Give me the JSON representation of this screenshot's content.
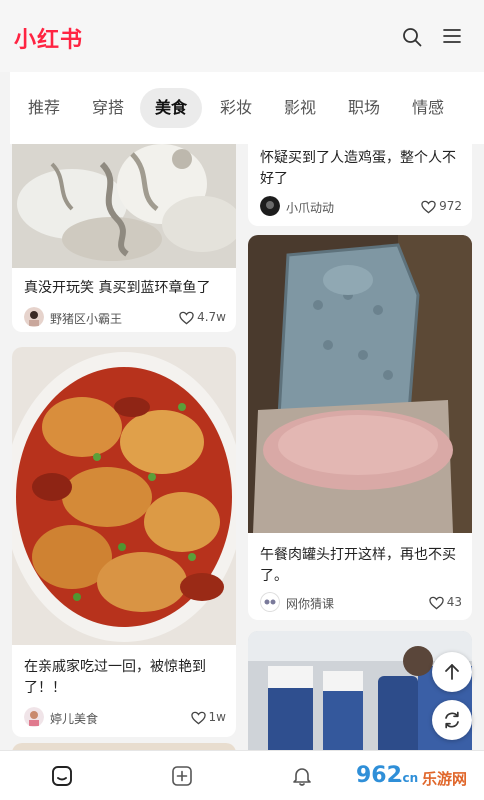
{
  "app": {
    "logo": "小红书",
    "accent": "#ff2442"
  },
  "header_icons": [
    "search-icon",
    "menu-icon"
  ],
  "tabs": [
    {
      "label": "推荐",
      "active": false
    },
    {
      "label": "穿搭",
      "active": false
    },
    {
      "label": "美食",
      "active": true
    },
    {
      "label": "彩妆",
      "active": false
    },
    {
      "label": "影视",
      "active": false
    },
    {
      "label": "职场",
      "active": false
    },
    {
      "label": "情感",
      "active": false
    }
  ],
  "feed": {
    "left": [
      {
        "title": "真没开玩笑 真买到蓝环章鱼了",
        "author": "野猪区小霸王",
        "likes": "4.7w",
        "image": "octopus-photo"
      },
      {
        "title": "在亲戚家吃过一回，被惊艳到了！！",
        "author": "婷儿美食",
        "likes": "1w",
        "image": "chicken-dish-photo"
      }
    ],
    "right": [
      {
        "title": "怀疑买到了人造鸡蛋，整个人不好了",
        "author": "小爪动动",
        "likes": "972",
        "image": "egg-photo"
      },
      {
        "title": "午餐肉罐头打开这样，再也不买了。",
        "author": "网你猜课",
        "likes": "43",
        "image": "canned-meat-photo"
      },
      {
        "title": "",
        "author": "",
        "likes": "",
        "image": "train-seats-photo"
      }
    ]
  },
  "floating": [
    "scroll-top-icon",
    "refresh-icon"
  ],
  "bottom_nav": [
    "home-icon",
    "publish-icon",
    "notification-icon"
  ],
  "watermark": {
    "brand": "962",
    "domain": ".cn",
    "site": "乐游网"
  }
}
